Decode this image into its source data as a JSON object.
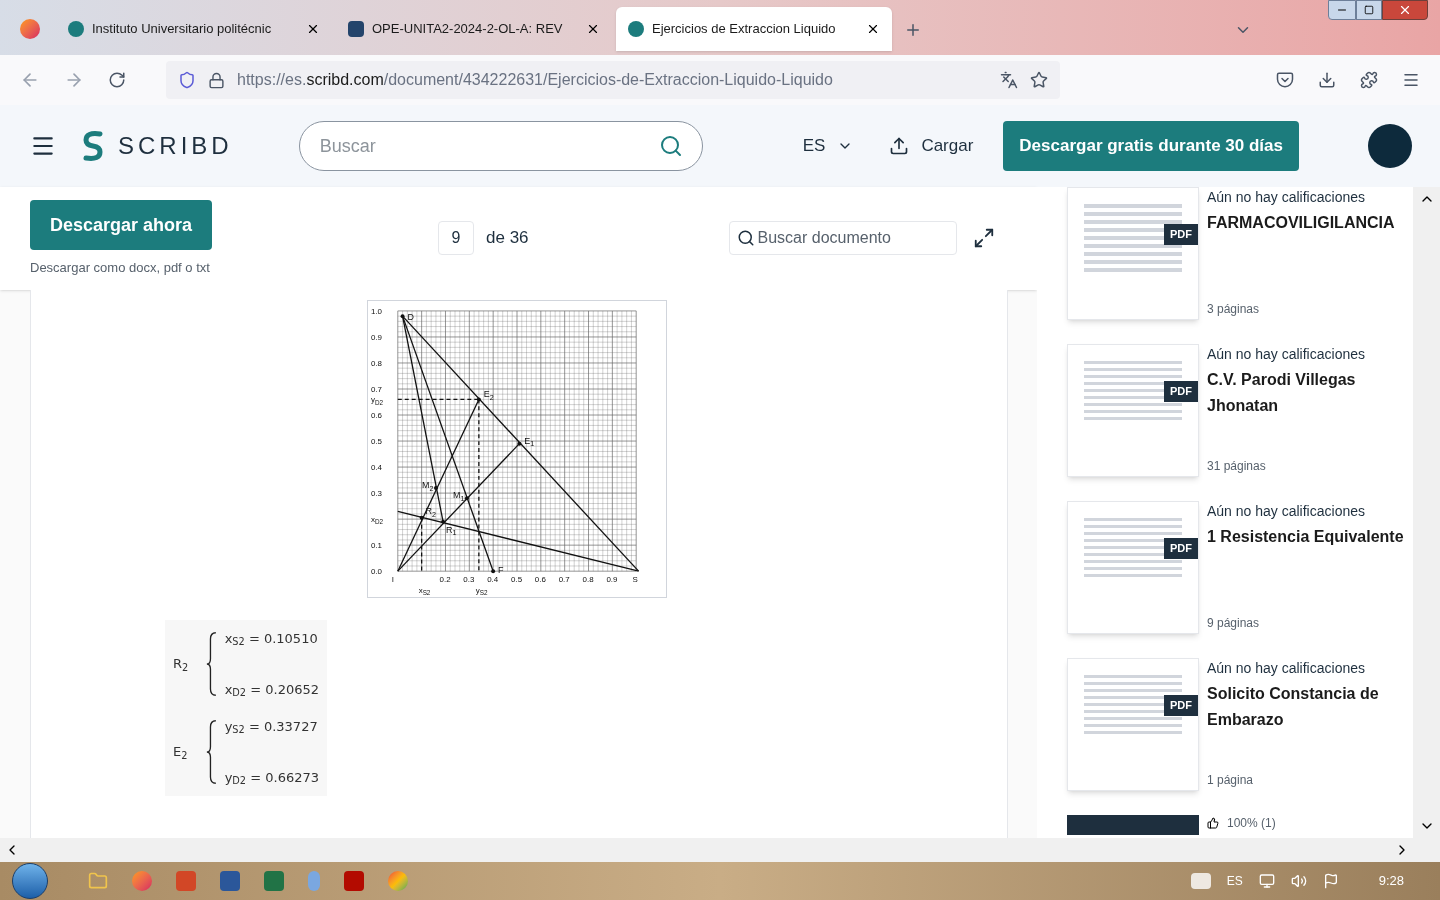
{
  "tabs": [
    {
      "title": "Instituto Universitario politécnic",
      "selected": false
    },
    {
      "title": "OPE-UNITA2-2024-2-OL-A: REV",
      "selected": false
    },
    {
      "title": "Ejercicios de Extraccion Liquido",
      "selected": true
    }
  ],
  "address": {
    "prefix": "https://es.",
    "domain": "scribd.com",
    "path": "/document/434222631/Ejercicios-de-Extraccion-Liquido-Liquido"
  },
  "header": {
    "logo": "SCRIBD",
    "search_placeholder": "Buscar",
    "language": "ES",
    "upload": "Cargar",
    "cta": "Descargar gratis durante 30 días"
  },
  "toolbar": {
    "download": "Descargar ahora",
    "download_note": "Descargar como docx, pdf o txt",
    "page": "9",
    "page_total": "de 36",
    "search_placeholder": "Buscar documento"
  },
  "diagram": {
    "yticks": [
      {
        "t": "1.0"
      },
      {
        "t": "0.9"
      },
      {
        "t": "0.8"
      },
      {
        "t": "0.7"
      },
      {
        "t": "y",
        "sub": "D2"
      },
      {
        "t": "0.6"
      },
      {
        "t": "0.5"
      },
      {
        "t": "0.4"
      },
      {
        "t": "0.3"
      },
      {
        "t": "x",
        "sub": "D2"
      },
      {
        "t": "0.1"
      },
      {
        "t": "0.0"
      }
    ],
    "xticks": [
      {
        "t": "I"
      },
      {
        "t": "x",
        "sub": "S2"
      },
      {
        "t": "0.2"
      },
      {
        "t": "0.3"
      },
      {
        "t": "y",
        "sub": "S2"
      },
      {
        "t": "0.4"
      },
      {
        "t": "0.5"
      },
      {
        "t": "0.6"
      },
      {
        "t": "0.7"
      },
      {
        "t": "0.8"
      },
      {
        "t": "0.9"
      },
      {
        "t": "S"
      }
    ],
    "points": [
      {
        "t": "D"
      },
      {
        "t": "E",
        "sub": "2"
      },
      {
        "t": "E",
        "sub": "1"
      },
      {
        "t": "M",
        "sub": "2"
      },
      {
        "t": "M",
        "sub": "1"
      },
      {
        "t": "R",
        "sub": "2"
      },
      {
        "t": "R",
        "sub": "1"
      },
      {
        "t": "F"
      }
    ]
  },
  "results": [
    {
      "label": "R$_{2}$",
      "lines": [
        "x$_{S2}$ = 0.10510",
        "x$_{D2}$ = 0.20652"
      ]
    },
    {
      "label": "E$_{2}$",
      "lines": [
        "y$_{S2}$ = 0.33727",
        "y$_{D2}$ = 0.66273"
      ]
    }
  ],
  "related": [
    {
      "rating": "Aún no hay calificaciones",
      "title": "FARMACOVILIGILANCIA",
      "pages": "3 páginas",
      "badge": "PDF"
    },
    {
      "rating": "Aún no hay calificaciones",
      "title": "C.V. Parodi Villegas Jhonatan",
      "pages": "31 páginas",
      "badge": "PDF"
    },
    {
      "rating": "Aún no hay calificaciones",
      "title": "1 Resistencia Equivalente",
      "pages": "9 páginas",
      "badge": "PDF"
    },
    {
      "rating": "Aún no hay calificaciones",
      "title": "Solicito Constancia de Embarazo",
      "pages": "1 página",
      "badge": "PDF"
    }
  ],
  "next_rating": "100% (1)",
  "taskbar": {
    "language": "ES",
    "time": "9:28"
  }
}
